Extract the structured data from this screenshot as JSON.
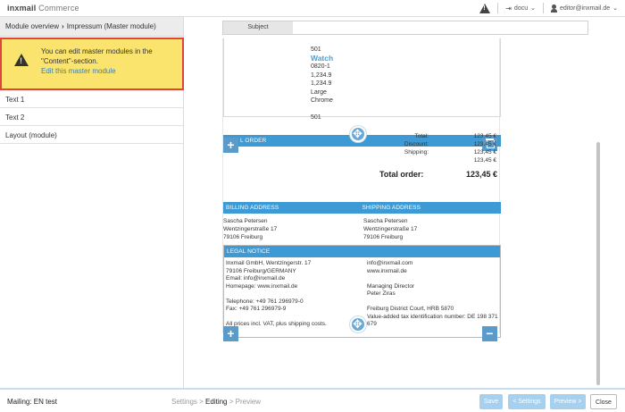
{
  "topbar": {
    "logo_brand": "inxmail",
    "logo_product": "Commerce",
    "logout_label": "docu",
    "user_label": "editor@inxmail.de"
  },
  "sidebar": {
    "breadcrumb_root": "Module overview",
    "breadcrumb_current": "Impressum (Master module)",
    "notice_text": "You can edit master modules in the \"Content\"-section.",
    "notice_link": "Edit this master module",
    "items": [
      {
        "label": "Text 1"
      },
      {
        "label": "Text 2"
      },
      {
        "label": "Layout (module)"
      }
    ]
  },
  "editor": {
    "subject_label": "Subject",
    "subject_value": "",
    "product_lines": [
      "501",
      "Watch",
      "0820-1",
      "1,234.9",
      "1,234.9",
      "Large",
      "Chrome",
      "",
      "501"
    ],
    "order_bar_label": "L ORDER",
    "totals": [
      {
        "label": "Total:",
        "value": "123,45 €"
      },
      {
        "label": "Discount:",
        "value": "123,45 €"
      },
      {
        "label": "Shipping:",
        "value": "123,45 €"
      },
      {
        "label": "",
        "value": "123,45 €"
      }
    ],
    "total_order_label": "Total order:",
    "total_order_value": "123,45 €",
    "billing_header": "BILLING ADDRESS",
    "shipping_header": "SHIPPING ADDRESS",
    "billing_lines": [
      "Sascha Petersen",
      "Wentzingerstraße 17",
      "79106 Freiburg"
    ],
    "shipping_lines": [
      "Sascha Petersen",
      "Wentzingerstraße 17",
      "79106 Freiburg"
    ],
    "legal_header": "LEGAL NOTICE",
    "legal_left": [
      "Inxmail GmbH, Wentzingerstr. 17",
      "79106 Freiburg/GERMANY",
      "Email: info@inxmail.de",
      "Homepage: www.inxmail.de",
      "",
      "Telephone: +49 761 296979-0",
      "Fax: +49 761 296979-9",
      "",
      "All prices incl. VAT, plus shipping costs."
    ],
    "legal_right": [
      "info@inxmail.com",
      "www.inxmail.de",
      "",
      "Managing Director",
      "Peter Ziras",
      "",
      "Freiburg District Court, HRB 5870",
      "Value-added tax identification number: DE 198 371",
      "679"
    ]
  },
  "footer": {
    "mailing": "Mailing: EN test",
    "step_settings": "Settings",
    "step_editing": "Editing",
    "step_preview": "Preview",
    "step_sep": " > ",
    "save": "Save",
    "settings_btn": "< Settings",
    "preview_btn": "Preview >",
    "close": "Close"
  },
  "colors": {
    "accent_blue": "#3d9ad4",
    "notice_yellow": "#fbe46e",
    "notice_border": "#e0443c"
  }
}
